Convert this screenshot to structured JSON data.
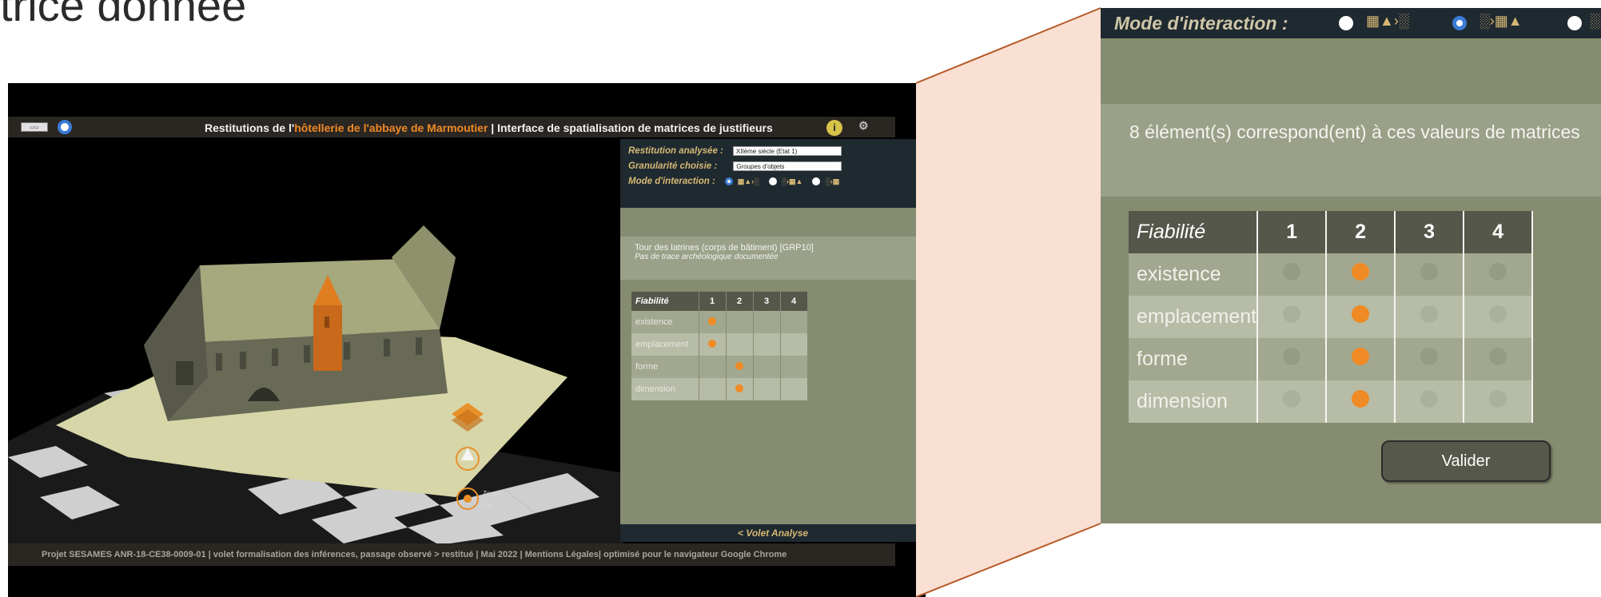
{
  "slide": {
    "title_fragment": "trice donnée"
  },
  "app": {
    "header": {
      "title_prefix": "Restitutions de l'",
      "title_highlight": "hôtellerie de l'abbaye de Marmoutier",
      "title_suffix": " | Interface de spatialisation de matrices de justifieurs",
      "info_icon": "info-icon",
      "settings_icon": "settings-icon"
    },
    "panel": {
      "restitution_label": "Restitution analysée :",
      "restitution_value": "XIIème siècle (Etat 1)",
      "granularite_label": "Granularité choisie :",
      "granularite_value": "Groupes d'objets",
      "mode_label": "Mode d'interaction :",
      "selected_name": "Tour des latrines (corps de bâtiment) [GRP10]",
      "selected_note": "Pas de trace archéologique documentée",
      "table": {
        "header": "Fiabilité",
        "columns": [
          "1",
          "2",
          "3",
          "4"
        ],
        "rows": [
          {
            "label": "existence",
            "marked": 1
          },
          {
            "label": "emplacement",
            "marked": 1
          },
          {
            "label": "forme",
            "marked": 2
          },
          {
            "label": "dimension",
            "marked": 2
          }
        ]
      },
      "footer": "< Volet Analyse"
    },
    "scene": {
      "zoom_label": "Zoom",
      "pan_label": "Pan"
    },
    "footer": "Projet SESAMES ANR-18-CE38-0009-01 | volet formalisation des inférences, passage observé > restitué | Mai 2022 | Mentions Légales| optimisé pour le navigateur Google Chrome"
  },
  "zoom": {
    "mode_label": "Mode d'interaction :",
    "result_text": "8 élément(s) correspond(ent) à ces valeurs de matrices",
    "table": {
      "header": "Fiabilité",
      "columns": [
        "1",
        "2",
        "3",
        "4"
      ],
      "rows": [
        {
          "label": "existence",
          "marked": 2
        },
        {
          "label": "emplacement",
          "marked": 2
        },
        {
          "label": "forme",
          "marked": 2
        },
        {
          "label": "dimension",
          "marked": 2
        }
      ]
    },
    "validate_label": "Valider"
  },
  "colors": {
    "accent_orange": "#f08a24",
    "panel_dark": "#1f2930",
    "panel_olive": "#858c6f",
    "radio_blue": "#3a7bd5"
  }
}
